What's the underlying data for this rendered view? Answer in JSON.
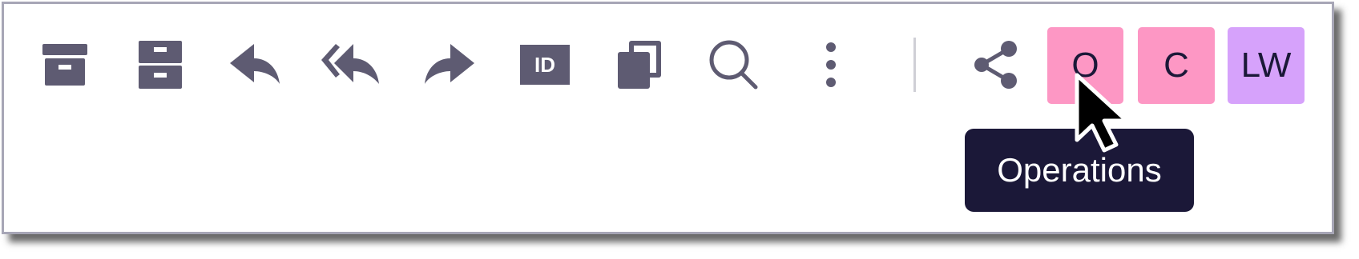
{
  "toolbar": {
    "icons": [
      {
        "name": "archive-icon"
      },
      {
        "name": "move-to-inbox-icon"
      },
      {
        "name": "reply-icon"
      },
      {
        "name": "reply-all-icon"
      },
      {
        "name": "forward-icon"
      },
      {
        "name": "id-icon"
      },
      {
        "name": "copy-icon"
      },
      {
        "name": "search-icon"
      },
      {
        "name": "more-vertical-icon"
      },
      {
        "name": "share-icon"
      }
    ],
    "icon_color": "#5e5b72"
  },
  "avatars": [
    {
      "label": "O",
      "color": "#fd97c4"
    },
    {
      "label": "C",
      "color": "#fd97c4"
    },
    {
      "label": "LW",
      "color": "#d6a2fb"
    }
  ],
  "tooltip": {
    "text": "Operations"
  }
}
